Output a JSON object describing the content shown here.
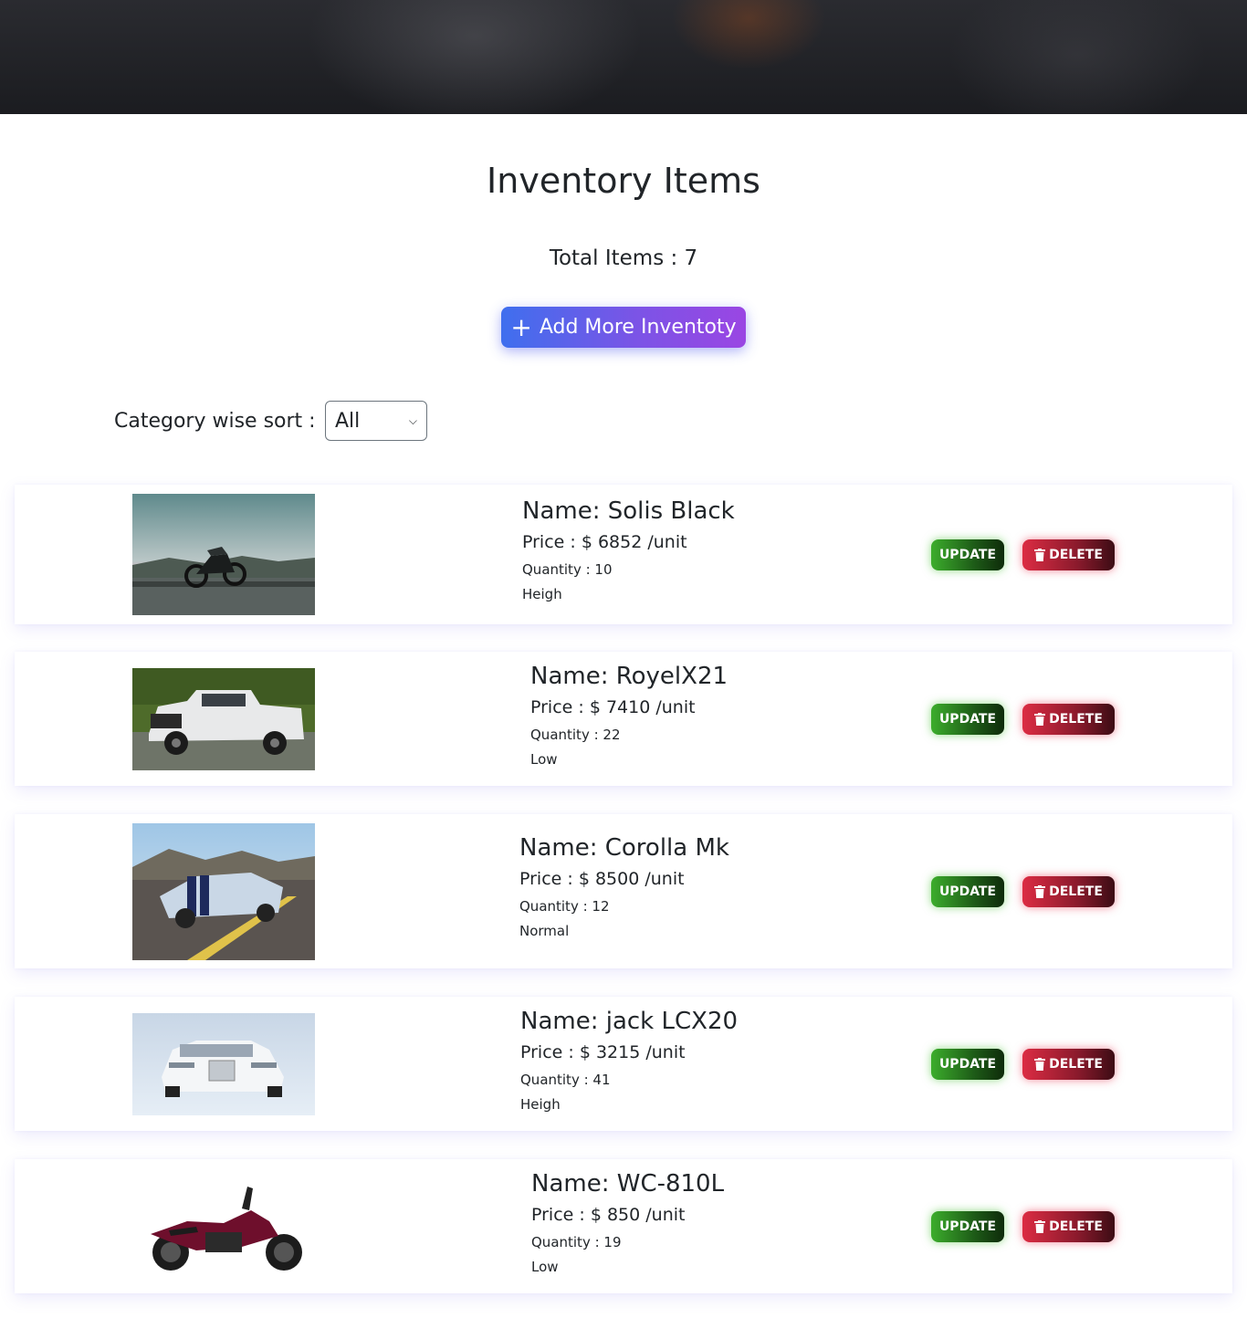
{
  "page": {
    "title": "Inventory Items",
    "total_label": "Total Items : 7",
    "add_button_label": "Add More Inventoty",
    "sort_label": "Category wise sort :",
    "sort_selected": "All"
  },
  "buttons": {
    "update_label": "UPDATE",
    "delete_label": "DELETE"
  },
  "items": [
    {
      "name": "Name: Solis Black",
      "price": "Price : $ 6852 /unit",
      "quantity": "Quantity : 10",
      "level": "Heigh",
      "image": "motorcycle-photo"
    },
    {
      "name": "Name: RoyelX21",
      "price": "Price : $ 7410 /unit",
      "quantity": "Quantity : 22",
      "level": "Low",
      "image": "pickup-truck-photo"
    },
    {
      "name": "Name: Corolla Mk",
      "price": "Price : $ 8500 /unit",
      "quantity": "Quantity : 12",
      "level": "Normal",
      "image": "sports-car-photo"
    },
    {
      "name": "Name: jack LCX20",
      "price": "Price : $ 3215 /unit",
      "quantity": "Quantity : 41",
      "level": "Heigh",
      "image": "luxury-sedan-photo"
    },
    {
      "name": "Name: WC-810L",
      "price": "Price : $ 850 /unit",
      "quantity": "Quantity : 19",
      "level": "Low",
      "image": "cruiser-motorcycle-photo"
    }
  ],
  "colors": {
    "update": "#2e8b22",
    "delete": "#dc2c43",
    "add_button": "#5a62ea"
  }
}
